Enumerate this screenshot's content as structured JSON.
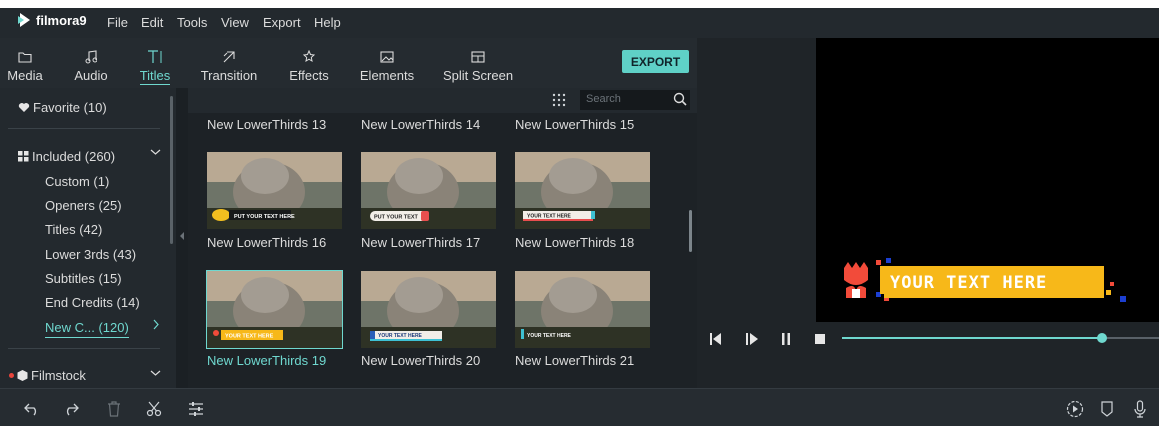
{
  "app": {
    "brand": "filmora9"
  },
  "menu": [
    "File",
    "Edit",
    "Tools",
    "View",
    "Export",
    "Help"
  ],
  "tabs": [
    {
      "label": "Media",
      "icon": "folder-icon"
    },
    {
      "label": "Audio",
      "icon": "music-note-icon"
    },
    {
      "label": "Titles",
      "icon": "titles-icon",
      "active": true
    },
    {
      "label": "Transition",
      "icon": "transition-icon"
    },
    {
      "label": "Effects",
      "icon": "effects-icon"
    },
    {
      "label": "Elements",
      "icon": "image-icon"
    },
    {
      "label": "Split Screen",
      "icon": "split-screen-icon"
    }
  ],
  "export_label": "EXPORT",
  "sidebar": {
    "favorite": "Favorite (10)",
    "included": "Included (260)",
    "items": [
      "Custom (1)",
      "Openers (25)",
      "Titles (42)",
      "Lower 3rds (43)",
      "Subtitles (15)",
      "End Credits (14)",
      "New C... (120)"
    ],
    "filmstock": "Filmstock"
  },
  "search": {
    "placeholder": "Search"
  },
  "grid": {
    "row_top": [
      "New LowerThirds 13",
      "New LowerThirds 14",
      "New LowerThirds 15"
    ],
    "items": [
      {
        "label": "New LowerThirds 16",
        "overlay": "PUT YOUR TEXT HERE"
      },
      {
        "label": "New LowerThirds 17",
        "overlay": "PUT YOUR TEXT"
      },
      {
        "label": "New LowerThirds 18",
        "overlay": "YOUR TEXT HERE"
      },
      {
        "label": "New LowerThirds 19",
        "overlay": "YOUR TEXT HERE",
        "selected": true
      },
      {
        "label": "New LowerThirds 20",
        "overlay": "YOUR TEXT HERE"
      },
      {
        "label": "New LowerThirds 21",
        "overlay": "YOUR TEXT HERE"
      }
    ]
  },
  "preview": {
    "overlay_text": "YOUR TEXT HERE",
    "progress": 0.82
  },
  "colors": {
    "accent": "#6fd8cf",
    "banner": "#f7b819",
    "tulip": "#f24b3a"
  }
}
